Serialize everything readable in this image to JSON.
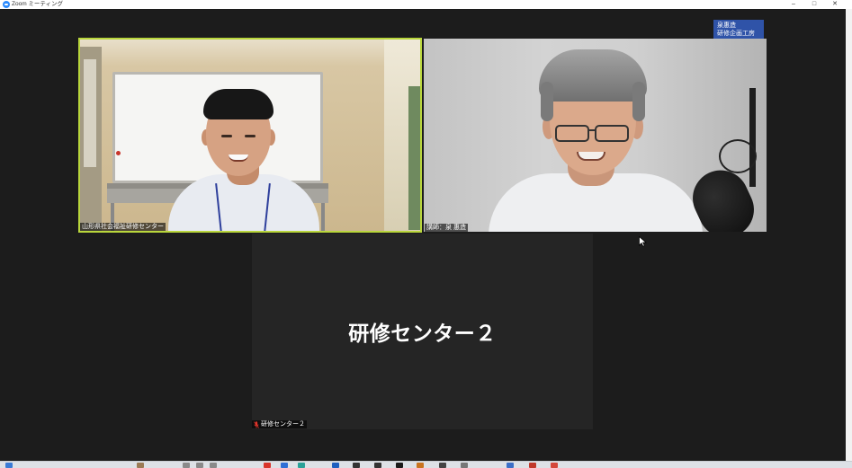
{
  "window": {
    "title": "Zoom ミーティング",
    "app_icon": "zoom-icon",
    "controls": {
      "minimize": "–",
      "maximize": "□",
      "close": "✕"
    }
  },
  "watermark_badge": {
    "line1": "泉惠造",
    "line2": "研修企画工房"
  },
  "colors": {
    "meeting_background": "#1c1c1c",
    "active_speaker_border": "#b9d63c",
    "badge": "#2f53a8",
    "muted_mic": "#e0352b",
    "camera_off_tile": "#252525",
    "zoom_blue": "#2d8cff"
  },
  "tiles": [
    {
      "name": "山形県社会福祉研修センター",
      "active_speaker": true,
      "camera_on": true
    },
    {
      "name": "講師：泉 惠造",
      "active_speaker": false,
      "camera_on": true
    },
    {
      "name": "研修センター２",
      "display_name": "研修センター２",
      "active_speaker": false,
      "camera_on": false,
      "muted": true,
      "mic_icon": "muted-microphone-icon"
    }
  ],
  "taskbar": {
    "icons": [
      {
        "name": "start-icon",
        "color": "#3a7bd5"
      },
      {
        "name": "taskbar-app-icon",
        "color": "#9b7b55"
      },
      {
        "name": "taskbar-app-icon",
        "color": "#8a8a8a"
      },
      {
        "name": "taskbar-app-icon",
        "color": "#8a8a8a"
      },
      {
        "name": "taskbar-app-icon",
        "color": "#8a8a8a"
      },
      {
        "name": "taskbar-app-icon",
        "color": "#d9342b"
      },
      {
        "name": "taskbar-app-icon",
        "color": "#2f6fd6"
      },
      {
        "name": "taskbar-app-icon",
        "color": "#2aa198"
      },
      {
        "name": "taskbar-app-icon",
        "color": "#1f5fbf"
      },
      {
        "name": "taskbar-app-icon",
        "color": "#333333"
      },
      {
        "name": "taskbar-app-icon",
        "color": "#333333"
      },
      {
        "name": "taskbar-app-icon",
        "color": "#1a1a1a"
      },
      {
        "name": "taskbar-app-icon",
        "color": "#c9741f"
      },
      {
        "name": "taskbar-app-icon",
        "color": "#444444"
      },
      {
        "name": "taskbar-app-icon",
        "color": "#777777"
      },
      {
        "name": "taskbar-app-icon",
        "color": "#3b6fc7"
      },
      {
        "name": "taskbar-app-icon",
        "color": "#c0392b"
      },
      {
        "name": "taskbar-app-icon",
        "color": "#d4473b"
      }
    ]
  }
}
